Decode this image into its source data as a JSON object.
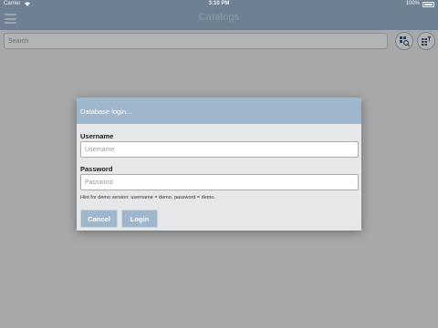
{
  "status_bar": {
    "carrier": "Carrier",
    "time": "3:10 PM",
    "battery": "100%"
  },
  "nav": {
    "title": "Catalogs"
  },
  "search": {
    "placeholder": "Search"
  },
  "dialog": {
    "title": "Database login...",
    "username_label": "Username",
    "username_placeholder": "Username",
    "password_label": "Password",
    "password_placeholder": "Password",
    "hint": "Hint for demo version: username = demo, password = demo.",
    "cancel_label": "Cancel",
    "login_label": "Login"
  },
  "colors": {
    "nav_bar": "#6f8093",
    "dialog_header": "#9fb7cc",
    "overlay_background": "#a6a8a9"
  },
  "icons": [
    "menu-icon",
    "wifi-icon",
    "battery-icon",
    "search-catalog-icon",
    "grid-filter-icon"
  ]
}
